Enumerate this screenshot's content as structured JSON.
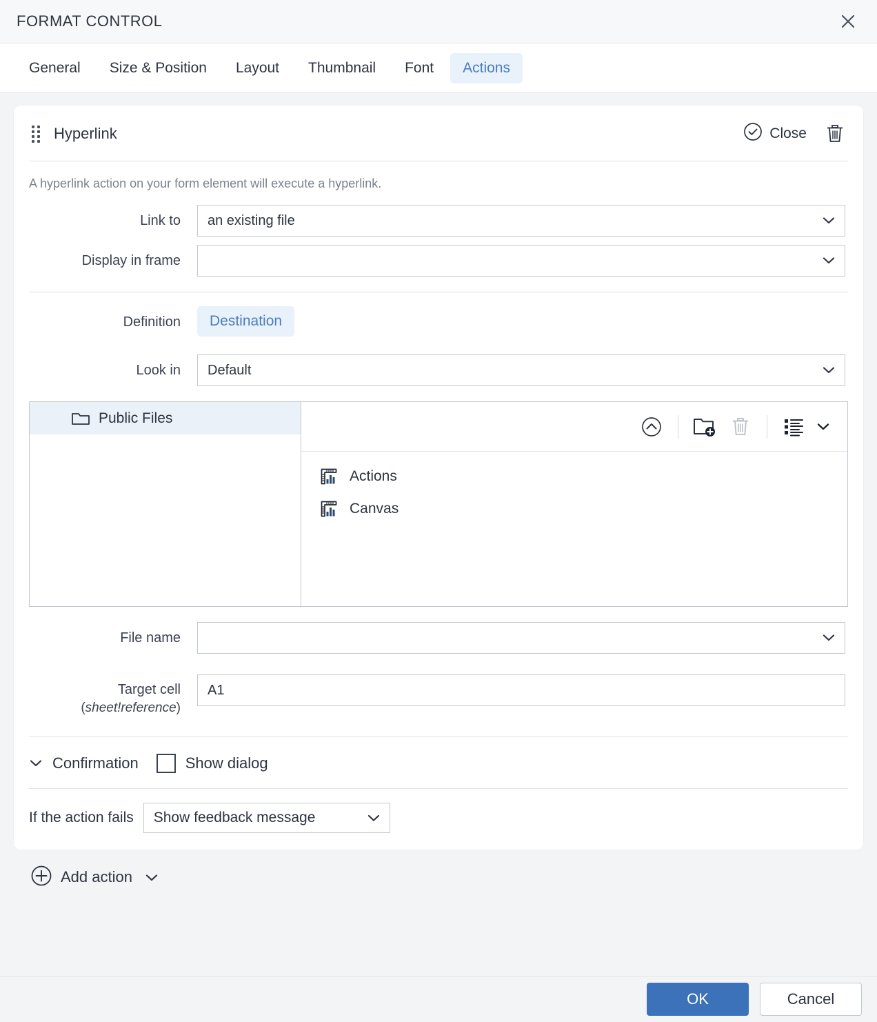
{
  "window": {
    "title": "FORMAT CONTROL",
    "close_icon": "close-icon"
  },
  "tabs": [
    {
      "label": "General",
      "active": false
    },
    {
      "label": "Size & Position",
      "active": false
    },
    {
      "label": "Layout",
      "active": false
    },
    {
      "label": "Thumbnail",
      "active": false
    },
    {
      "label": "Font",
      "active": false
    },
    {
      "label": "Actions",
      "active": true
    }
  ],
  "action_card": {
    "title": "Hyperlink",
    "drag_handle_icon": "drag-handle-icon",
    "close_label": "Close",
    "close_icon": "check-circle-icon",
    "delete_icon": "trash-icon",
    "description": "A hyperlink action on your form element will execute a hyperlink.",
    "link_to": {
      "label": "Link to",
      "value": "an existing file"
    },
    "display_in_frame": {
      "label": "Display in frame",
      "value": ""
    },
    "definition": {
      "label": "Definition",
      "button_label": "Destination"
    },
    "look_in": {
      "label": "Look in",
      "value": "Default"
    },
    "browser": {
      "tree": [
        {
          "label": "Public Files",
          "icon": "folder-icon",
          "selected": true
        }
      ],
      "toolbar": [
        {
          "name": "up-level-icon"
        },
        {
          "name": "new-folder-icon"
        },
        {
          "name": "delete-icon"
        },
        {
          "name": "list-view-icon"
        },
        {
          "name": "chevron-down-icon"
        }
      ],
      "files": [
        {
          "label": "Actions",
          "icon": "spreadsheet-icon"
        },
        {
          "label": "Canvas",
          "icon": "spreadsheet-icon"
        }
      ]
    },
    "file_name": {
      "label": "File name",
      "value": ""
    },
    "target_cell": {
      "label": "Target cell",
      "sub_label": "(sheet!reference)",
      "sub_italic": "sheet!reference",
      "value": "A1"
    },
    "confirmation": {
      "caret_icon": "chevron-down-icon",
      "label": "Confirmation",
      "checkbox_label": "Show dialog",
      "checked": false
    },
    "on_fail": {
      "label": "If the action fails",
      "value": "Show feedback message"
    }
  },
  "add_action": {
    "icon": "plus-circle-icon",
    "label": "Add action",
    "caret_icon": "chevron-down-icon"
  },
  "footer": {
    "ok_label": "OK",
    "cancel_label": "Cancel"
  },
  "colors": {
    "accent": "#4a7ebb",
    "accent_bg": "#e9f1fb",
    "primary_button": "#3c72b9",
    "page_bg": "#f3f4f6",
    "border": "#c3c8ce"
  }
}
